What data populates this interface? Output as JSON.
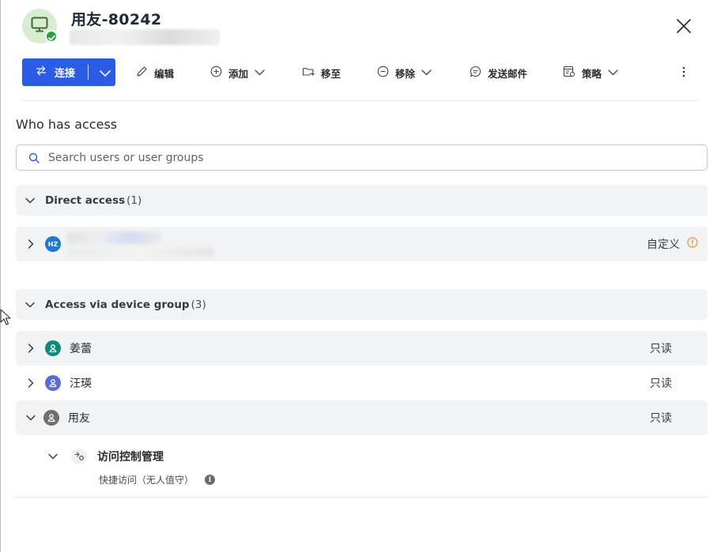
{
  "device": {
    "title": "用友-80242",
    "status_color": "#23a13b",
    "avatar_bg": "#d8eccf"
  },
  "toolbar": {
    "connect_label": "连接",
    "edit_label": "编辑",
    "add_label": "添加",
    "move_to_label": "移至",
    "remove_label": "移除",
    "send_email_label": "发送邮件",
    "policy_label": "策略",
    "accent": "#2b5ce6"
  },
  "access": {
    "section_title": "Who has access",
    "search_placeholder": "Search users or user groups",
    "direct": {
      "title": "Direct access",
      "count": "(1)",
      "rows": [
        {
          "initials": "HZ",
          "permission": "自定义",
          "avatar_color": "#1f76d6"
        }
      ]
    },
    "device_group": {
      "title": "Access via device group",
      "count": "(3)",
      "rows": [
        {
          "name": "姜蕾",
          "permission": "只读",
          "avatar_color": "#0e8a7c"
        },
        {
          "name": "汪瑛",
          "permission": "只读",
          "avatar_color": "#5a6bdc"
        },
        {
          "name": "用友",
          "permission": "只读",
          "avatar_color": "#6f6f6f"
        }
      ],
      "sub": {
        "name": "访问控制管理",
        "description": "快捷访问（无人值守）"
      }
    }
  },
  "icons": {
    "device": "monitor-icon",
    "status": "check-icon",
    "close": "close-icon",
    "connect": "swap-arrows-icon",
    "edit": "pencil-icon",
    "add": "plus-circle-icon",
    "move": "folder-move-icon",
    "remove": "minus-circle-icon",
    "email": "chat-bubble-icon",
    "policy": "policy-icon",
    "more": "kebab-icon",
    "warning": "info-circle-icon"
  },
  "colors": {
    "warning": "#e8912d"
  }
}
